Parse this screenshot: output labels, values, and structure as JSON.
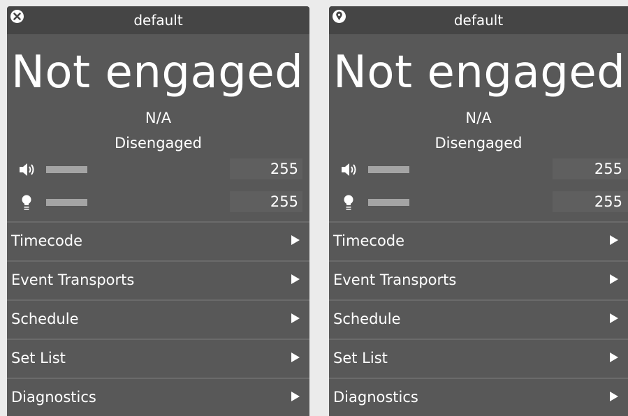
{
  "panels": [
    {
      "header": {
        "title": "default",
        "icon": "close-circle-icon"
      },
      "status": {
        "title": "Not engaged",
        "subtitle": "N/A",
        "state": "Disengaged"
      },
      "levels": {
        "volume": {
          "icon": "speaker-icon",
          "value": "255",
          "level": 1.0
        },
        "light": {
          "icon": "lightbulb-icon",
          "value": "255",
          "level": 1.0
        }
      },
      "menu": [
        {
          "label": "Timecode"
        },
        {
          "label": "Event Transports"
        },
        {
          "label": "Schedule"
        },
        {
          "label": "Set List"
        },
        {
          "label": "Diagnostics"
        }
      ]
    },
    {
      "header": {
        "title": "default",
        "icon": "map-pin-icon"
      },
      "status": {
        "title": "Not engaged",
        "subtitle": "N/A",
        "state": "Disengaged"
      },
      "levels": {
        "volume": {
          "icon": "speaker-icon",
          "value": "255",
          "level": 1.0
        },
        "light": {
          "icon": "lightbulb-icon",
          "value": "255",
          "level": 1.0
        }
      },
      "menu": [
        {
          "label": "Timecode"
        },
        {
          "label": "Event Transports"
        },
        {
          "label": "Schedule"
        },
        {
          "label": "Set List"
        },
        {
          "label": "Diagnostics"
        }
      ]
    }
  ],
  "colors": {
    "page_background": "#ebebeb",
    "panel_background": "#585858",
    "header_background": "#454545",
    "level_bar": "#a4a4a4",
    "text": "#ffffff"
  }
}
